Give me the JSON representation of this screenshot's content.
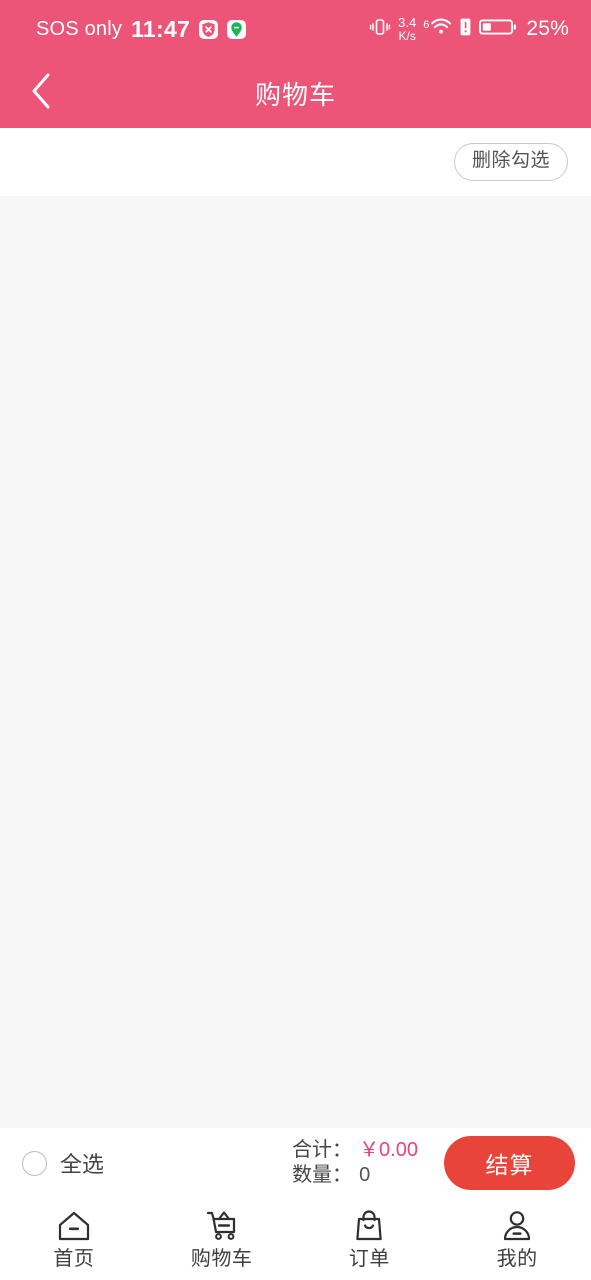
{
  "status_bar": {
    "carrier": "SOS only",
    "time": "11:47",
    "icons": [
      "shield-x-icon",
      "location-pin-icon",
      "vibrate-icon",
      "wifi-icon",
      "signal-alert-icon",
      "battery-icon"
    ],
    "net_speed_value": "3.4",
    "net_speed_unit": "K/s",
    "wifi_generation": "6",
    "battery_percent": "25%",
    "background_color": "#ec5578"
  },
  "header": {
    "title": "购物车",
    "back_icon": "chevron-left-icon",
    "background_color": "#ec5578",
    "text_color": "#ffffff"
  },
  "toolbar": {
    "delete_selected_label": "删除勾选"
  },
  "cart": {
    "items": [],
    "background_color": "#f6f6f6"
  },
  "summary": {
    "select_all_label": "全选",
    "select_all_checked": false,
    "total_label": "合计：",
    "total_value": "￥0.00",
    "total_color": "#e8437a",
    "quantity_label": "数量：",
    "quantity_value": "0",
    "checkout_label": "结算",
    "checkout_color": "#e8443a"
  },
  "bottom_nav": {
    "items": [
      {
        "label": "首页",
        "icon": "home-icon",
        "active": false
      },
      {
        "label": "购物车",
        "icon": "cart-icon",
        "active": false
      },
      {
        "label": "订单",
        "icon": "bag-icon",
        "active": false
      },
      {
        "label": "我的",
        "icon": "person-icon",
        "active": false
      }
    ]
  }
}
